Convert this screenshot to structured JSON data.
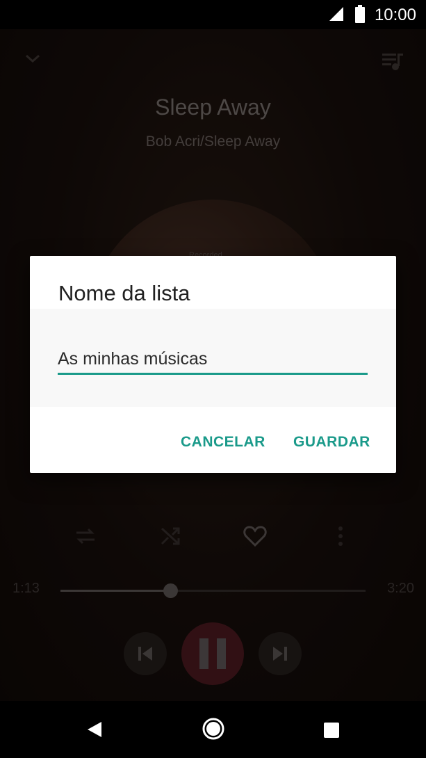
{
  "status_bar": {
    "time": "10:00"
  },
  "player": {
    "title": "Sleep Away",
    "artist_album": "Bob Acri/Sleep Away",
    "album_caption": "Recorded",
    "time_current": "1:13",
    "time_total": "3:20",
    "progress_fraction": 0.36
  },
  "dialog": {
    "title": "Nome da lista",
    "input_value": "As minhas músicas",
    "cancel_label": "CANCELAR",
    "save_label": "GUARDAR"
  },
  "colors": {
    "accent": "#1a9a8a",
    "play_button": "#5a1e26"
  },
  "icons": {
    "status": [
      "signal-icon",
      "battery-icon"
    ],
    "player_top": [
      "chevron-down-icon",
      "queue-music-icon"
    ],
    "player_controls": [
      "repeat-icon",
      "shuffle-icon",
      "heart-icon",
      "more-vert-icon"
    ],
    "transport": [
      "skip-previous-icon",
      "pause-icon",
      "skip-next-icon"
    ],
    "nav": [
      "back-icon",
      "home-icon",
      "recents-icon"
    ]
  }
}
